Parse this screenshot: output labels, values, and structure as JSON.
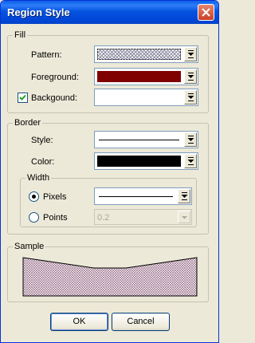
{
  "window": {
    "title": "Region Style",
    "close_icon": "close-icon"
  },
  "fill": {
    "legend": "Fill",
    "pattern_label": "Pattern:",
    "foreground_label": "Foreground:",
    "foreground_color": "#800000",
    "background_label": "Backgound:",
    "background_checked": true,
    "background_color": "#ffffff"
  },
  "border": {
    "legend": "Border",
    "style_label": "Style:",
    "color_label": "Color:",
    "color_value": "#000000",
    "width": {
      "legend": "Width",
      "pixels_label": "Pixels",
      "points_label": "Points",
      "selected": "Pixels",
      "points_value": "0.2"
    }
  },
  "sample": {
    "legend": "Sample"
  },
  "buttons": {
    "ok": "OK",
    "cancel": "Cancel"
  }
}
